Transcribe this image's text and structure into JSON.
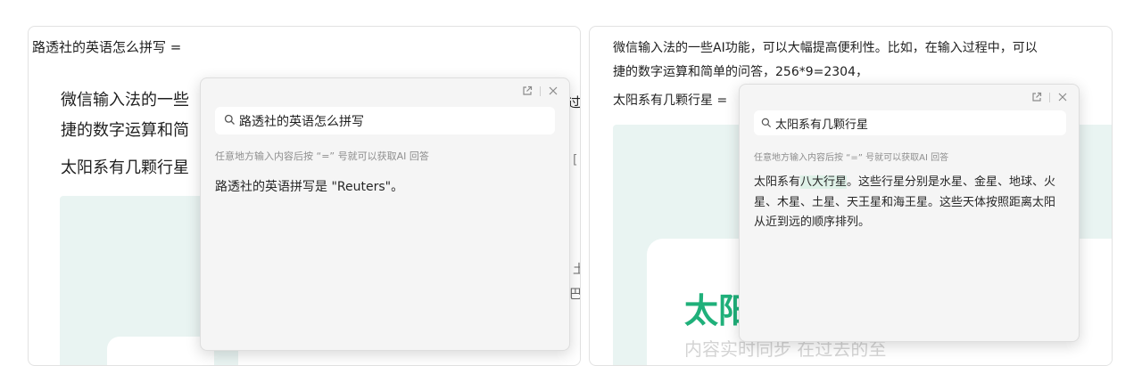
{
  "left": {
    "line1": "路透社的英语怎么拼写 =",
    "body_line1": "微信输入法的一些",
    "body_line2": "捷的数字运算和简",
    "body_line3": "太阳系有几颗行星",
    "edge_char_1": "过",
    "edge_char_2": "[",
    "edge_char_3": "土",
    "edge_char_4": "巴",
    "edge_char_5": "卡",
    "popup": {
      "query": "路透社的英语怎么拼写",
      "hint": "任意地方输入内容后按 “=” 号就可以获取AI 回答",
      "answer": "路透社的英语拼写是 \"Reuters\"。",
      "external_icon": "open-external-icon",
      "close_icon": "close-icon"
    }
  },
  "right": {
    "line1": "微信输入法的一些AI功能，可以大幅提高便利性。比如，在输入过程中，可以",
    "line2": "捷的数字运算和简单的问答，256*9=2304，",
    "line3": "太阳系有几颗行星 =",
    "big_text": "太阳",
    "faded_text": "内容实时同步 在过去的至",
    "popup": {
      "query": "太阳系有几颗行星",
      "hint": "任意地方输入内容后按 “=” 号就可以获取AI 回答",
      "answer_prefix": "太阳系有",
      "answer_highlight": "八大行星",
      "answer_rest": "。这些行星分别是水星、金星、地球、火星、木星、土星、天王星和海王星。这些天体按照距离太阳从近到远的顺序排列。",
      "external_icon": "open-external-icon",
      "close_icon": "close-icon"
    }
  },
  "colors": {
    "accent_green": "#1fb07a",
    "highlight": "#dff1e8",
    "popup_bg": "#f5f5f5"
  }
}
